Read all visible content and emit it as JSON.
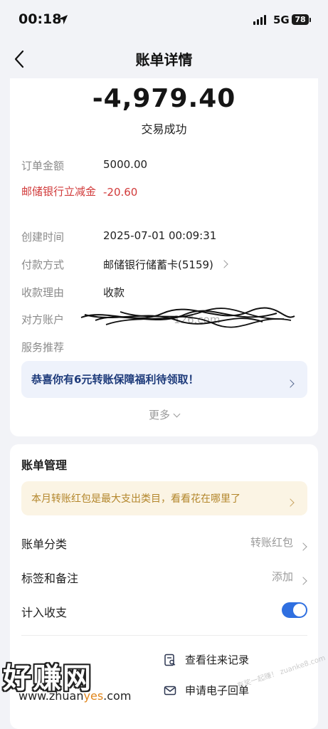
{
  "status_bar": {
    "time": "00:18",
    "network": "5G",
    "battery": "78"
  },
  "nav": {
    "title": "账单详情"
  },
  "transaction": {
    "amount": "-4,979.40",
    "status": "交易成功"
  },
  "details": {
    "order_amount_label": "订单金额",
    "order_amount_value": "5000.00",
    "discount_label": "邮储银行立减金",
    "discount_value": "-20.60",
    "created_label": "创建时间",
    "created_value": "2025-07-01 00:09:31",
    "payment_label": "付款方式",
    "payment_value": "邮储银行储蓄卡(5159)",
    "reason_label": "收款理由",
    "reason_value": "收款",
    "counterparty_label": "对方账户",
    "counterparty_visible_fragment": "126.com",
    "service_label": "服务推荐"
  },
  "promo_banner": "恭喜你有6元转账保障福利待领取！",
  "more_label": "更多",
  "management": {
    "title": "账单管理",
    "insight_banner": "本月转账红包是最大支出类目，看看花在哪里了",
    "category_label": "账单分类",
    "category_value": "转账红包",
    "tags_label": "标签和备注",
    "tags_value": "添加",
    "income_label": "计入收支",
    "income_enabled": true,
    "actions": {
      "history": "查看往来记录",
      "receipt": "申请电子回单"
    }
  },
  "watermark": {
    "logo": "好赚网",
    "url_prefix": "www.zhuan",
    "url_accent": "yes",
    "url_suffix": ".com",
    "faint_text": "有奖一起赚！ zuanke8.com"
  },
  "colors": {
    "accent_blue": "#2f6fe0",
    "discount_red": "#d13a3a",
    "banner_yellow_text": "#b3862b"
  }
}
